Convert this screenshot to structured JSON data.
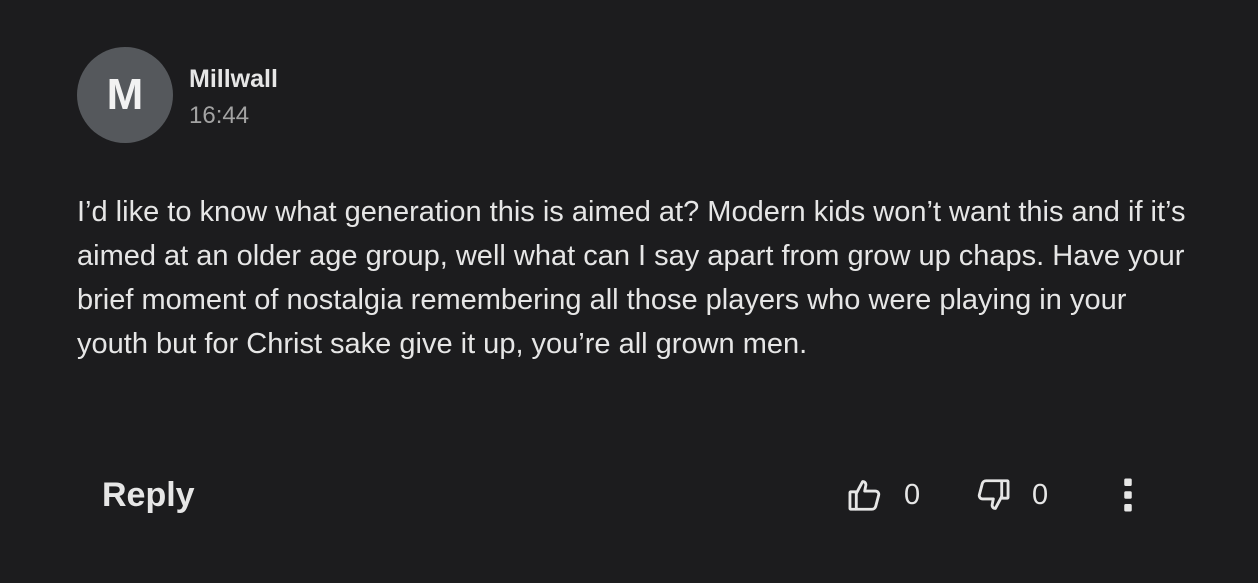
{
  "comment": {
    "avatar_initial": "M",
    "username": "Millwall",
    "timestamp": "16:44",
    "text": "I’d like to know what generation this is aimed at? Modern kids won’t want this and if it’s aimed at an older age group, well what can I say apart from grow up chaps. Have your brief moment of nostalgia remembering all those players who were playing in your youth but for Christ sake give it up, you’re all grown men.",
    "actions": {
      "reply_label": "Reply",
      "upvote_icon": "thumbs-up-icon",
      "upvote_count": "0",
      "downvote_icon": "thumbs-down-icon",
      "downvote_count": "0",
      "more_icon": "more-vertical-icon"
    }
  },
  "colors": {
    "background": "#1c1c1e",
    "avatar_background": "#55585c",
    "primary_text": "#e6e6e6",
    "secondary_text": "#a3a3a3"
  }
}
